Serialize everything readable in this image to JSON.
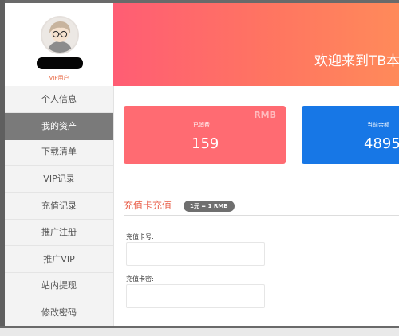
{
  "user": {
    "level": "VIP用户"
  },
  "sidebar": {
    "items": [
      {
        "label": "个人信息"
      },
      {
        "label": "我的资产",
        "active": true
      },
      {
        "label": "下载清单"
      },
      {
        "label": "VIP记录"
      },
      {
        "label": "充值记录"
      },
      {
        "label": "推广注册"
      },
      {
        "label": "推广VIP"
      },
      {
        "label": "站内提现"
      },
      {
        "label": "修改密码"
      }
    ]
  },
  "banner": {
    "welcome": "欢迎来到TB本"
  },
  "stats": {
    "spent": {
      "unit": "RMB",
      "label": "已消费",
      "value": "159"
    },
    "balance": {
      "label": "当前余额",
      "value": "4895"
    }
  },
  "recharge": {
    "title": "充值卡充值",
    "rate": "1元 = 1 RMB",
    "card_number_label": "充值卡号:",
    "card_password_label": "充值卡密:",
    "card_number_value": "",
    "card_password_value": ""
  },
  "colors": {
    "banner_gradient": [
      "#ff5d74",
      "#ff8a5a"
    ],
    "spent_card": "#ff6b72",
    "balance_card": "#1777e6",
    "accent": "#e85a44"
  }
}
